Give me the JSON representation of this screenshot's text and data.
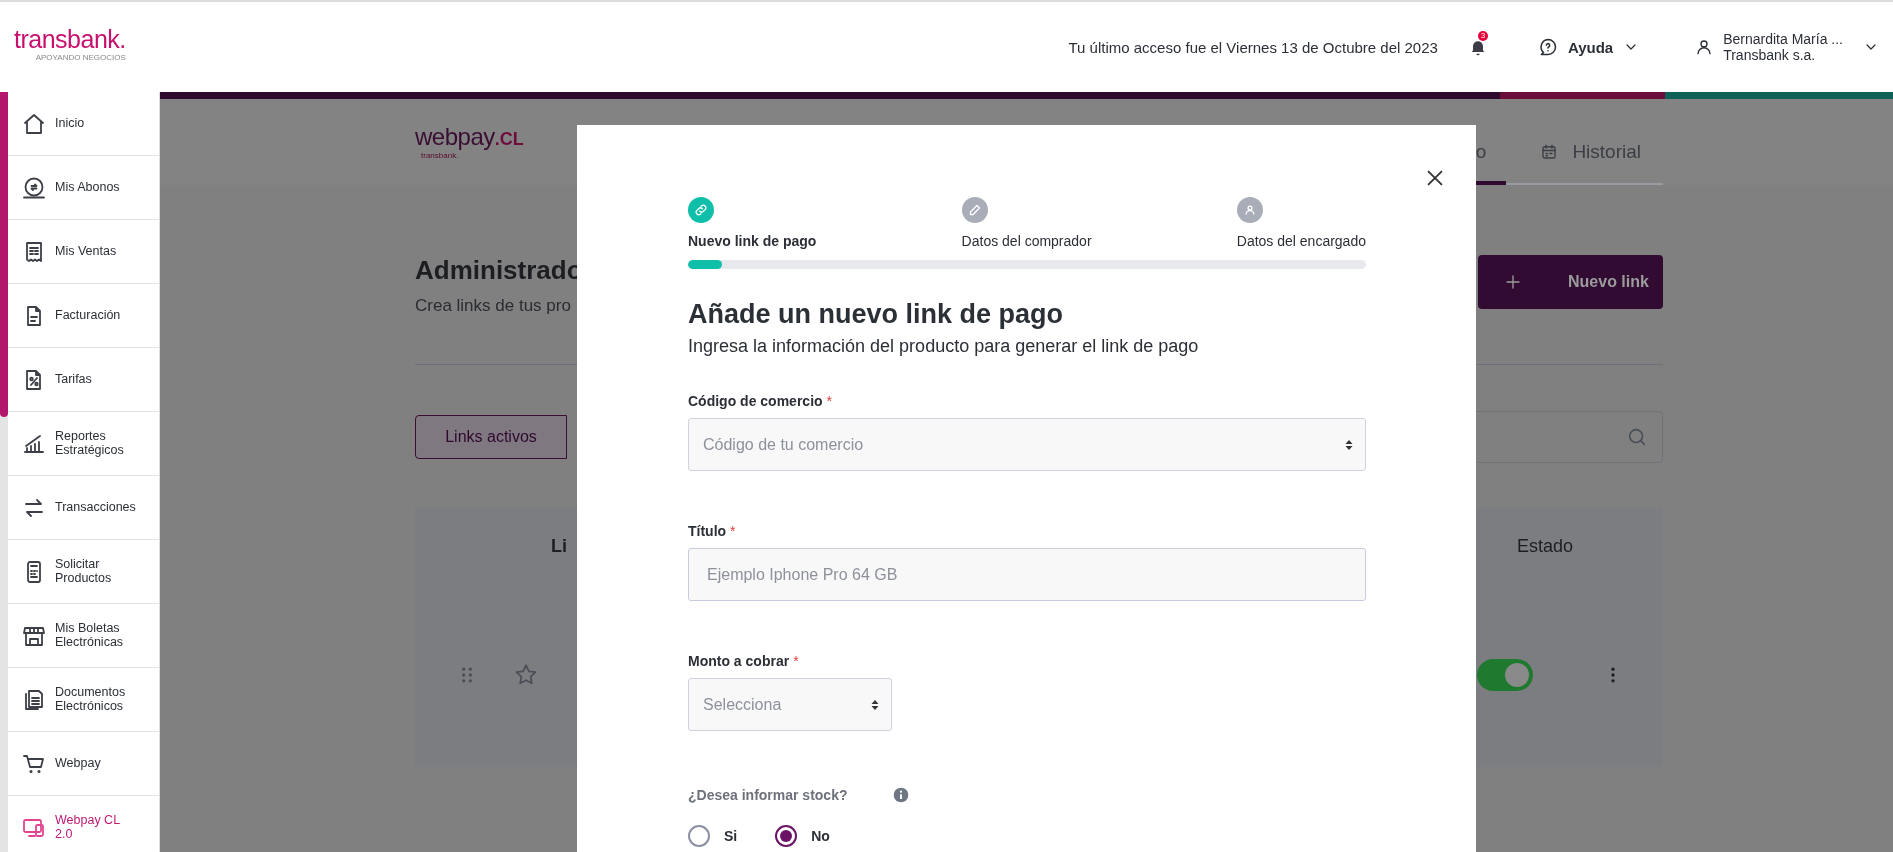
{
  "header": {
    "logo": {
      "name": "transbank.",
      "tagline": "APOYANDO NEGOCIOS"
    },
    "last_access": "Tu último acceso fue el Viernes 13 de Octubre del 2023",
    "notifications": {
      "count": "3"
    },
    "help": {
      "label": "Ayuda"
    },
    "user": {
      "name": "Bernardita María ...",
      "company": "Transbank s.a."
    }
  },
  "sidebar": {
    "items": [
      {
        "label": "Inicio",
        "selected": false
      },
      {
        "label": "Mis Abonos",
        "selected": false
      },
      {
        "label": "Mis Ventas",
        "selected": false
      },
      {
        "label": "Facturación",
        "selected": false
      },
      {
        "label": "Tarifas",
        "selected": false
      },
      {
        "label": "Reportes Estratégicos",
        "selected": false
      },
      {
        "label": "Transacciones",
        "selected": false
      },
      {
        "label": "Solicitar Productos",
        "selected": false
      },
      {
        "label": "Mis Boletas Electrónicas",
        "selected": false
      },
      {
        "label": "Documentos Electrónicos",
        "selected": false
      },
      {
        "label": "Webpay",
        "selected": false
      },
      {
        "label": "Webpay CL 2.0",
        "selected": true
      }
    ]
  },
  "page": {
    "logo": {
      "name": "webpay",
      "suffix": ".CL",
      "sub": "transbank."
    },
    "tabs": [
      {
        "label": "o",
        "selected": true
      },
      {
        "label": "Historial",
        "selected": false
      }
    ],
    "title": "Administrado",
    "subtitle": "Crea links de tus pro",
    "new_button": "Nuevo link",
    "filter_tabs": [
      {
        "label": "Links activos",
        "selected": true
      }
    ],
    "table": {
      "columns": [
        "Li",
        "Estado"
      ],
      "rows": [
        {
          "favorite": false,
          "on": true
        }
      ]
    }
  },
  "modal": {
    "steps": [
      {
        "label": "Nuevo link de pago",
        "active": true
      },
      {
        "label": "Datos del comprador",
        "active": false
      },
      {
        "label": "Datos del encargado",
        "active": false
      }
    ],
    "progress": {
      "level": 0.05
    },
    "title": "Añade un nuevo link de pago",
    "subtitle": "Ingresa la información del producto para generar el link de pago",
    "fields": [
      {
        "kind": "select",
        "label": "Código de comercio",
        "required_mark": "*",
        "placeholder": "Código de tu comercio"
      },
      {
        "kind": "text",
        "label": "Título",
        "required_mark": "*",
        "placeholder": "Ejemplo Iphone Pro 64 GB"
      },
      {
        "kind": "amount",
        "label": "Monto a cobrar",
        "required_mark": "*",
        "placeholder": "Selecciona"
      }
    ],
    "stock": {
      "question": "¿Desea informar stock?",
      "options": [
        {
          "label": "Si",
          "selected": false
        },
        {
          "label": "No",
          "selected": true
        }
      ]
    }
  }
}
